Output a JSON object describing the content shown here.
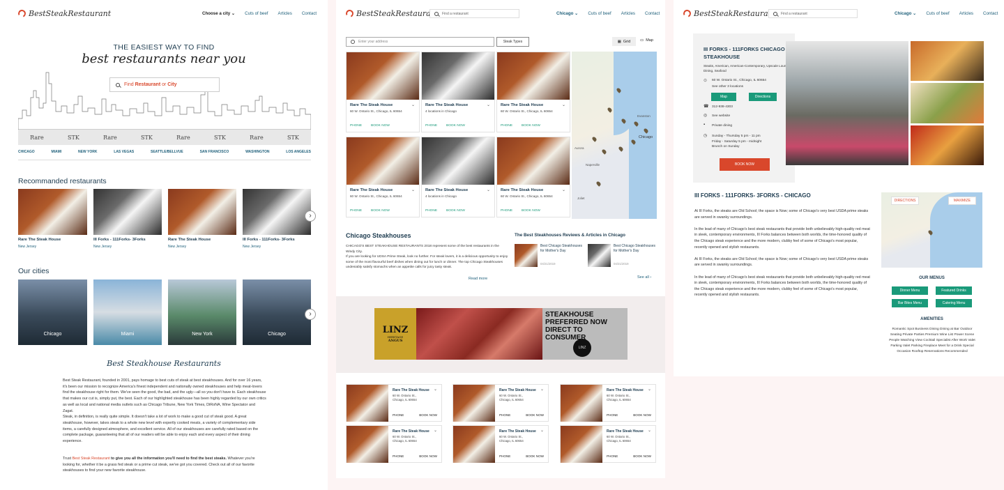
{
  "brand": "BestSteakRestaurant",
  "colors": {
    "accent": "#d9472b",
    "teal": "#1a9a7a",
    "navy": "#1e3c50"
  },
  "nav": {
    "city": "Choose a city",
    "city_alt": "Chicago",
    "cuts": "Cuts of beef",
    "articles": "Articles",
    "contact": "Contact"
  },
  "find_placeholder": "Find a restaurant",
  "home": {
    "hero_line1": "THE EASIEST WAY TO FIND",
    "hero_line2": "best restaurants near you",
    "search_find": "Find",
    "search_restaurant": "Restaurant",
    "search_or": "or",
    "search_city": "City",
    "brands": [
      "Rare",
      "STK",
      "Rare",
      "STK",
      "Rare",
      "STK",
      "Rare",
      "STK"
    ],
    "cities": [
      "CHICAGO",
      "MIAMI",
      "NEW YORK",
      "LAS VEGAS",
      "SEATTLE/BELLVUE",
      "SAN FRANCISCO",
      "WASHINGTON",
      "LOS ANGELES"
    ],
    "recommended_title": "Recommanded restaurants",
    "recommended": [
      {
        "name": "Rare The Steak House",
        "loc": "New Jersey"
      },
      {
        "name": "III Forks - 111Forks- 3Forks",
        "loc": "New Jersey"
      },
      {
        "name": "Rare The Steak House",
        "loc": "New Jersey"
      },
      {
        "name": "III Forks - 111Forks- 3Forks",
        "loc": "New Jersey"
      }
    ],
    "our_cities_title": "Our cities",
    "our_cities": [
      "Chicago",
      "Miami",
      "New York",
      "Chicago"
    ],
    "section_title": "Best Steakhouse Restaurants",
    "body1": "Best Steak Restaurant, founded in 2001, pays homage to best cuts of steak at best steakhouses. And for over 16 years, it's been our mission to recognize America's finest independent and nationally owned steakhouses and help meat-lovers find the steakhouse right for them. We've seen the good, the bad, and the ugly—all so you don't have to. Each steakhouse that makes our cut is, simply put, the best. Each of our highlighted steakhouse has been highly regarded by our own critics as well as local and national media outlets such as Chicago Tribune, New York Times, DiRoNA, Wine Spectator and Zagat.",
    "body2": "Steak, in definition, is really quite simple. It doesn't take a lot of work to make a good cut of steak good. A great steakhouse, however, takes steak to a whole new level with expertly cooked meats, a variety of complementary side items, a carefully designed atmosphere, and excellent service. All of our steakhouses are carefully rated based on the complete package, guaranteeing that all of our readers will be able to enjoy each and every aspect of their dining experience.",
    "body3_a": "Trust ",
    "body3_link": "Best Steak Restaurant",
    "body3_b": " to give you all the information you'll need to find the best steaks.",
    "body3_c": " Whatever you're looking for, whether it be a grass fed steak or a prime cut steak, we've got you covered. Check out all of our favorite steakhouses to find your new favorite steakhouse."
  },
  "list": {
    "address_placeholder": "Enter your address",
    "steak_types": "Steak Types",
    "grid": "Grid",
    "map": "Map",
    "cards": [
      {
        "name": "Rare The Steak House",
        "addr": "60 W. Ontario St., Chicago, IL 60654"
      },
      {
        "name": "Rare The Steak House",
        "addr": "4 locations in Chicago"
      },
      {
        "name": "Rare The Steak House",
        "addr": "60 W. Ontario St., Chicago, IL 60654"
      },
      {
        "name": "Rare The Steak House",
        "addr": "60 W. Ontario St., Chicago, IL 60654"
      },
      {
        "name": "Rare The Steak House",
        "addr": "4 locations in Chicago"
      },
      {
        "name": "Rare The Steak House",
        "addr": "60 W. Ontario St., Chicago, IL 60654"
      }
    ],
    "phone": "PHONE",
    "book": "BOOK NOW",
    "map_labels": [
      "Evanston",
      "Chicago",
      "Aurora",
      "Naperville",
      "Joliet"
    ],
    "chi_title": "Chicago Steakhouses",
    "chi_text1": "CHICAGO'S BEST STEAKHOUSE RESTAURANTS 2018 represent some of the best restaurants in the Windy City.",
    "chi_text2": "If you are looking for UDSA Prime Steak, look no further. For steak lovers, it is a delicious opportunity to enjoy some of the most flavourful beef dishes when dining out for lunch or dinner. The top Chicago Steakhouses undeniably satisfy stomachs when an appetite calls for juicy tasty steak.",
    "read_more": "Read more",
    "reviews_title": "The Best Steakhouses Reviews & Articles in Chicago",
    "articles": [
      {
        "title": "Best Chicago Steakhouses for Mother's Day",
        "date": "04/21/2019"
      },
      {
        "title": "Best Chicago Steakhouses for Mother's Day",
        "date": "04/21/2019"
      }
    ],
    "see_all": "See all",
    "ad_brand": "LINZ",
    "ad_sub1": "HERITAGE",
    "ad_sub2": "ANGUS",
    "ad_headline": "STEAKHOUSE PREFERRED NOW DIRECT TO CONSUMER",
    "ad_seal": "LINZ",
    "mini_cards": [
      {
        "name": "Rare The Steak House",
        "addr": "60 W. Ontario St., Chicago, IL 60654"
      },
      {
        "name": "Rare The Steak House",
        "addr": "60 W. Ontario St., Chicago, IL 60654"
      },
      {
        "name": "Rare The Steak House",
        "addr": "60 W. Ontario St., Chicago, IL 60654"
      },
      {
        "name": "Rare The Steak House",
        "addr": "60 W. Ontario St., Chicago, IL 60654"
      },
      {
        "name": "Rare The Steak House",
        "addr": "60 W. Ontario St., Chicago, IL 60654"
      },
      {
        "name": "Rare The Steak House",
        "addr": "60 W. Ontario St., Chicago, IL 60654"
      }
    ]
  },
  "detail": {
    "name": "III FORKS - 111FORKS CHICAGO STEAKHOUSE",
    "cuisine": "Steaks, American, American-Contemporary, Upscale Lounge Dining, Seafood",
    "address": "60 W. Ontario St., Chicago, IL 60654",
    "other_locations": "See other 3 locations",
    "map_btn": "Map",
    "directions_btn": "Directions",
    "phone": "312-938-4303",
    "website": "See website",
    "private": "Private dining",
    "hours1": "Sunday - Thursday 5 pm - 11 pm",
    "hours2": "Friday - Saturday 5 pm - midnight",
    "hours3": "Brunch on Sunday",
    "book": "BOOK NOW",
    "heading": "III FORKS - 111FORKS- 3FORKS - CHICAGO",
    "text1": "At III Forks, the steaks are Old School; the space is Now; some of Chicago's very best USDA prime steaks are served in swanky surroundings.",
    "text2": "In the lead of many of Chicago's best steak restaurants that provide both unbelievably high-quality red meat in sleek, contemporary environments, III Forks balances between both worlds, the time-honored quality of the Chicago steak experience and the more modern, clubby feel of some of Chicago's most popular, recently opened and stylish restaurants.",
    "text3": "At III Forks, the steaks are Old School; the space is Now; some of Chicago's very best USDA prime steaks are served in swanky surroundings.",
    "text4": "In the lead of many of Chicago's best steak restaurants that provide both unbelievably high-quality red meat in sleek, contemporary environments, III Forks balances between both worlds, the time-honored quality of the Chicago steak experience and the more modern, clubby feel of some of Chicago's most popular, recently opened and stylish restaurants.",
    "map_directions": "DIRECTIONS",
    "map_maximize": "MAXIMIZE",
    "menus_title": "OUR MENUS",
    "menus": [
      "Dinner Menu",
      "Featured Drinks",
      "Bar Bites Menu",
      "Catering Menu"
    ],
    "amenities_title": "AMENITIES",
    "amenities": "Romantic Spot Business Dining Dining at Bar Outdoor Seating Private Parties Premium Wine List Power Scene People Watching View Cocktail Specialist After Work Valet Parking Valet Parking Fireplace Meet for a Drink Special Occasion Rooftop Reservations Recommended"
  }
}
